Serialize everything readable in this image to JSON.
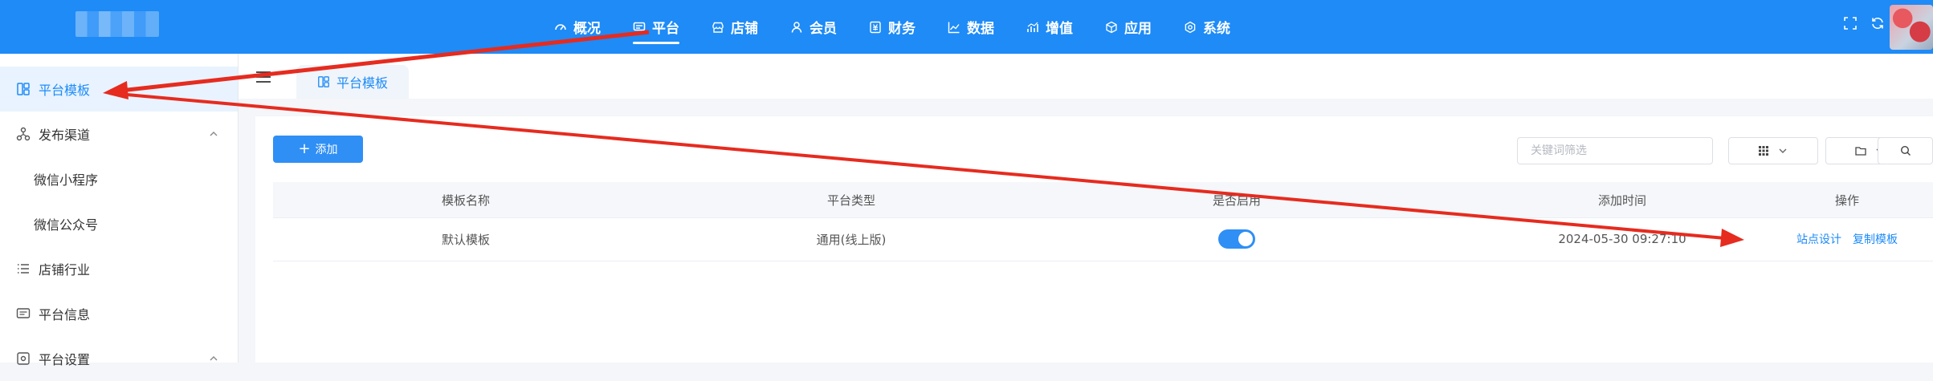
{
  "topnav": {
    "items": [
      {
        "label": "概况",
        "icon": "dashboard-icon"
      },
      {
        "label": "平台",
        "icon": "platform-icon",
        "active": true
      },
      {
        "label": "店铺",
        "icon": "store-icon"
      },
      {
        "label": "会员",
        "icon": "user-icon"
      },
      {
        "label": "财务",
        "icon": "finance-icon"
      },
      {
        "label": "数据",
        "icon": "chart-icon"
      },
      {
        "label": "增值",
        "icon": "growth-icon"
      },
      {
        "label": "应用",
        "icon": "cube-icon"
      },
      {
        "label": "系统",
        "icon": "gear-icon"
      }
    ]
  },
  "sidebar": {
    "items": [
      {
        "label": "平台模板",
        "icon": "template-icon",
        "active": true
      },
      {
        "label": "发布渠道",
        "icon": "channel-icon",
        "expanded": true
      },
      {
        "label": "微信小程序",
        "sub": true
      },
      {
        "label": "微信公众号",
        "sub": true
      },
      {
        "label": "店铺行业",
        "icon": "list-icon"
      },
      {
        "label": "平台信息",
        "icon": "info-icon"
      },
      {
        "label": "平台设置",
        "icon": "settings-icon",
        "expanded": true
      }
    ]
  },
  "tab": {
    "label": "平台模板"
  },
  "toolbar": {
    "add_label": "添加",
    "search_placeholder": "关键词筛选"
  },
  "table": {
    "headers": [
      "模板名称",
      "平台类型",
      "是否启用",
      "添加时间",
      "操作"
    ],
    "rows": [
      {
        "name": "默认模板",
        "type": "通用(线上版)",
        "enabled": true,
        "time": "2024-05-30 09:27:10",
        "actions": [
          "站点设计",
          "复制模板"
        ]
      }
    ]
  },
  "colors": {
    "primary": "#1e8bf7",
    "annotation_arrow": "#e62b1f"
  }
}
